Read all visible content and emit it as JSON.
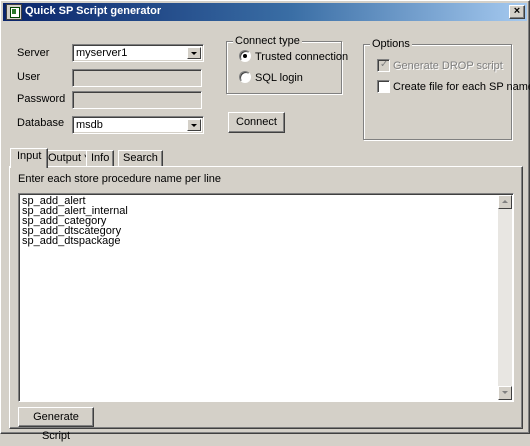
{
  "window": {
    "title": "Quick SP Script generator",
    "close_glyph": "×"
  },
  "connection": {
    "server_label": "Server",
    "server_value": "myserver1",
    "user_label": "User",
    "user_value": "",
    "password_label": "Password",
    "password_value": "",
    "database_label": "Database",
    "database_value": "msdb"
  },
  "connect_type": {
    "title": "Connect type",
    "trusted_label": "Trusted connection",
    "trusted_checked": true,
    "sql_label": "SQL login",
    "sql_checked": false,
    "connect_button": "Connect"
  },
  "options": {
    "title": "Options",
    "generate_drop_label": "Generate DROP script",
    "generate_drop_checked": true,
    "generate_drop_enabled": false,
    "create_file_label": "Create file for each SP name",
    "create_file_checked": false
  },
  "tabs": [
    {
      "label": "Input",
      "active": true
    },
    {
      "label": "Output ***",
      "active": false
    },
    {
      "label": "Info",
      "active": false
    },
    {
      "label": "Search",
      "active": false
    }
  ],
  "input_panel": {
    "instruction": "Enter each store procedure name per line",
    "procedures": [
      "sp_add_alert",
      "sp_add_alert_internal",
      "sp_add_category",
      "sp_add_dtscategory",
      "sp_add_dtspackage"
    ],
    "generate_button": "Generate Script"
  },
  "icons": {
    "app": "sp-generator-app-icon",
    "close": "close-icon",
    "dropdown": "chevron-down-icon"
  }
}
